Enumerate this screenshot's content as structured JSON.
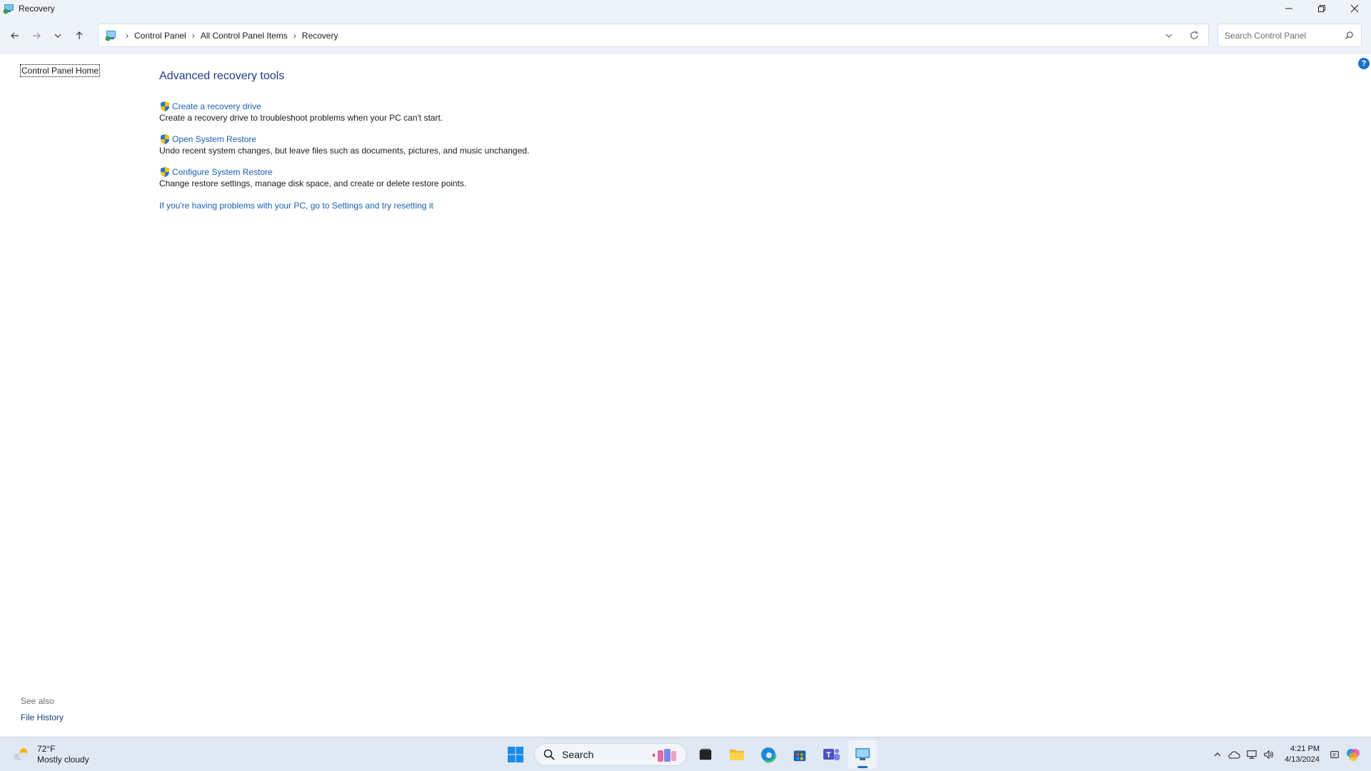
{
  "window": {
    "title": "Recovery",
    "controls": {
      "minimize": "minimize",
      "restore": "restore",
      "close": "close"
    }
  },
  "address_bar": {
    "breadcrumbs": [
      "Control Panel",
      "All Control Panel Items",
      "Recovery"
    ]
  },
  "search": {
    "placeholder": "Search Control Panel"
  },
  "left_pane": {
    "home_link": "Control Panel Home",
    "see_also_label": "See also",
    "see_also_items": [
      "File History"
    ]
  },
  "main": {
    "heading": "Advanced recovery tools",
    "items": [
      {
        "label": "Create a recovery drive",
        "description": "Create a recovery drive to troubleshoot problems when your PC can't start."
      },
      {
        "label": "Open System Restore",
        "description": "Undo recent system changes, but leave files such as documents, pictures, and music unchanged."
      },
      {
        "label": "Configure System Restore",
        "description": "Change restore settings, manage disk space, and create or delete restore points."
      }
    ],
    "reset_link": "If you're having problems with your PC, go to Settings and try resetting it"
  },
  "help": {
    "glyph": "?"
  },
  "taskbar": {
    "weather": {
      "temp": "72°F",
      "condition": "Mostly cloudy"
    },
    "search_label": "Search",
    "clock": {
      "time": "4:21 PM",
      "date": "4/13/2024"
    }
  },
  "colors": {
    "link": "#1a5fb4",
    "heading": "#1e3a8a",
    "chrome": "#eef3f9",
    "taskbar": "#dfe8f3"
  }
}
